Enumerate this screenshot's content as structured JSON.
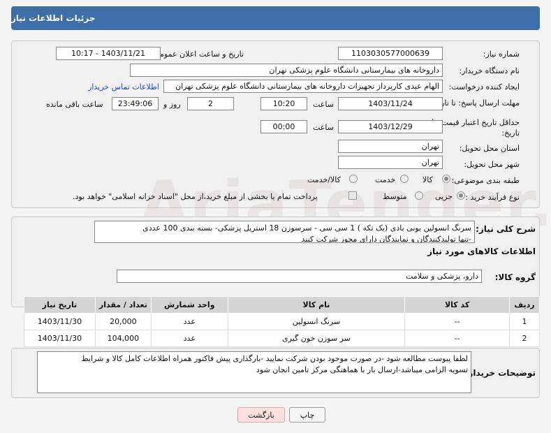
{
  "header": {
    "title": "جزئیات اطلاعات نیاز"
  },
  "form": {
    "need_number": {
      "label": "شماره نیاز:",
      "value": "1103030577000639"
    },
    "announce_datetime": {
      "label": "تاریخ و ساعت اعلان عمومی:",
      "value": "1403/11/21 - 10:17"
    },
    "buyer_org": {
      "label": "نام دستگاه خریدار:",
      "value": "داروخانه های بیمارستانی دانشگاه علوم پزشکی تهران"
    },
    "requester": {
      "label": "ایجاد کننده درخواست:",
      "value": "الهام عبدی کارپرداز تجهیزات داروخانه های بیمارستانی دانشگاه علوم پزشکی تهران",
      "contact_link": "اطلاعات تماس خریدار"
    },
    "deadline": {
      "label": "مهلت ارسال پاسخ: تا تاریخ:",
      "date": "1403/11/24",
      "time_label": "ساعت",
      "time": "10:20",
      "days": "2",
      "days_label": "روز و",
      "remaining": "23:49:06",
      "remaining_label": "ساعت باقی مانده"
    },
    "min_validity": {
      "label": "حداقل تاریخ اعتبار قیمت: تا تاریخ:",
      "date": "1403/12/29",
      "time_label": "ساعت",
      "time": "00:00"
    },
    "province": {
      "label": "استان محل تحویل:",
      "value": "تهران"
    },
    "city": {
      "label": "شهر محل تحویل:",
      "value": "تهران"
    },
    "category": {
      "label": "طبقه بندی موضوعی:",
      "options": [
        "کالا",
        "خدمت",
        "کالا/خدمت"
      ]
    },
    "purchase_type": {
      "label": "نوع فرآیند خرید :",
      "options": [
        "جزیی",
        "متوسط"
      ],
      "note": "پرداخت تمام یا بخشی از مبلغ خرید،از محل \"اسناد خزانه اسلامی\" خواهد بود."
    }
  },
  "summary": {
    "label": "شرح کلی نیاز:",
    "text": "سرنگ انسولین یونی بادی (یک تکه ) 1 سی سی - سرسوزن 18 استریل پزشکی- بسته بندی 100 عددی\n-تنها تولیدکنندگان و نمایندگان دارای مجوز شرکت کنند"
  },
  "goods_section": {
    "title": "اطلاعات کالاهای مورد نیاز"
  },
  "goods_group": {
    "label": "گروه کالا:",
    "value": "دارو، پزشکی و سلامت"
  },
  "table": {
    "headers": [
      "ردیف",
      "کد کالا",
      "نام کالا",
      "واحد شمارش",
      "تعداد / مقدار",
      "تاریخ نیاز"
    ],
    "rows": [
      [
        "1",
        "--",
        "سرنگ انسولین",
        "عدد",
        "20,000",
        "1403/11/30"
      ],
      [
        "2",
        "--",
        "سر سوزن خون گیری",
        "عدد",
        "104,000",
        "1403/11/30"
      ]
    ]
  },
  "buyer_notes": {
    "label": "توضیحات خریدار:",
    "text": "لطفا پیوست مطالعه شود -در صورت موجود بودن شرکت نمایید -بارگذاری پیش فاکتور همراه اطلاعات کامل کالا و شرایط\nتسویه الزامی میباشد-ارسال بار با هماهنگی مرکز تامین انجان شود"
  },
  "buttons": {
    "print": "چاپ",
    "back": "بازگشت"
  },
  "watermark": "AriaTender.neT"
}
